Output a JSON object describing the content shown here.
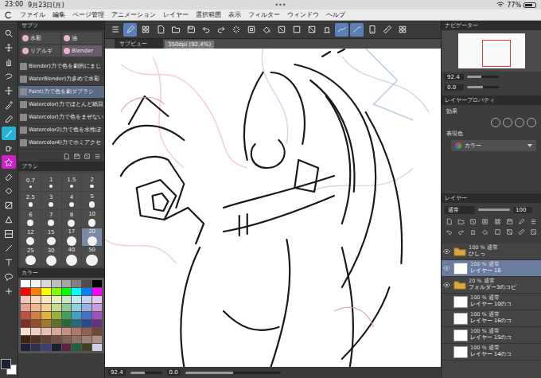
{
  "status_bar": {
    "time": "23:00",
    "date": "9月23日(月)",
    "dots": "•••",
    "battery": "77%",
    "battery_level": 0.77
  },
  "menu": [
    "ファイル",
    "編集",
    "ページ管理",
    "アニメーション",
    "レイヤー",
    "選択範囲",
    "表示",
    "フィルター",
    "ウィンドウ",
    "ヘルプ"
  ],
  "command_bar": [
    {
      "kind": "menu",
      "selected": false
    },
    {
      "kind": "pen",
      "selected": true
    },
    {
      "kind": "grid",
      "selected": false
    },
    {
      "kind": "file",
      "selected": false
    },
    {
      "kind": "folder",
      "selected": false
    },
    {
      "kind": "save",
      "selected": false
    },
    {
      "kind": "undo",
      "selected": false
    },
    {
      "kind": "redo",
      "selected": false
    },
    {
      "kind": "loading",
      "selected": false
    },
    {
      "kind": "transform",
      "selected": false
    },
    {
      "kind": "fill",
      "selected": false
    },
    {
      "kind": "clear",
      "selected": false
    },
    {
      "kind": "deselect",
      "selected": false
    },
    {
      "kind": "invert",
      "selected": false
    },
    {
      "kind": "snap",
      "selected": false
    },
    {
      "kind": "stabA",
      "selected": true
    },
    {
      "kind": "stabB",
      "selected": true
    },
    {
      "kind": "tablet",
      "selected": false
    },
    {
      "kind": "ruler",
      "selected": false
    },
    {
      "kind": "grid",
      "selected": false
    }
  ],
  "subview": {
    "label": "サブビュー"
  },
  "canvas_tab": {
    "title": "350dpi (92.4%)"
  },
  "tools": [
    {
      "kind": "zoom",
      "selected": false
    },
    {
      "kind": "move",
      "selected": false
    },
    {
      "kind": "hand",
      "selected": false
    },
    {
      "kind": "lasso",
      "selected": false
    },
    {
      "kind": "move",
      "selected": false
    },
    {
      "kind": "eyedrop",
      "selected": false
    },
    {
      "kind": "pencil",
      "selected": false
    },
    {
      "kind": "brush",
      "selected": true
    },
    {
      "kind": "airbrush",
      "selected": false
    },
    {
      "kind": "decoration",
      "selected": false
    },
    {
      "kind": "eraser",
      "selected": false
    },
    {
      "kind": "bucket",
      "selected": false
    },
    {
      "kind": "gradient",
      "selected": false
    },
    {
      "kind": "figure",
      "selected": false
    },
    {
      "kind": "frame",
      "selected": false
    },
    {
      "kind": "line",
      "selected": false
    },
    {
      "kind": "text",
      "selected": false
    },
    {
      "kind": "balloon",
      "selected": false
    },
    {
      "kind": "correct",
      "selected": false
    }
  ],
  "subtool_panel": {
    "title": "サブツ",
    "groups": [
      {
        "label": "水彩",
        "selected": false
      },
      {
        "label": "油",
        "selected": false
      },
      {
        "label": "リアルギ",
        "selected": false
      },
      {
        "label": "Blender",
        "selected": true
      }
    ],
    "items": [
      {
        "label": "Blender)力で色を劇的にまじ",
        "selected": false
      },
      {
        "label": "WaterBlender)力多めで水彩",
        "selected": false
      },
      {
        "label": "Paint)力で色を劇ダブラシ",
        "selected": true
      },
      {
        "label": "Watercolor)力でほとんど紙目",
        "selected": false
      },
      {
        "label": "Watercolor)力で色をまぜない",
        "selected": false
      },
      {
        "label": "Watercolor2)力で色を水性ぼ",
        "selected": false
      },
      {
        "label": "Watercolor4)力でホミアクセ",
        "selected": false
      }
    ]
  },
  "brush_size": {
    "title": "ブラシ",
    "sizes": [
      {
        "label": "0.7",
        "selected": false
      },
      {
        "label": "1",
        "selected": false
      },
      {
        "label": "1.5",
        "selected": false
      },
      {
        "label": "2",
        "selected": false
      },
      {
        "label": "2.5",
        "selected": false
      },
      {
        "label": "3",
        "selected": false
      },
      {
        "label": "4",
        "selected": false
      },
      {
        "label": "5",
        "selected": false
      },
      {
        "label": "6",
        "selected": false
      },
      {
        "label": "7",
        "selected": false
      },
      {
        "label": "8",
        "selected": false
      },
      {
        "label": "10",
        "selected": false
      },
      {
        "label": "12",
        "selected": false
      },
      {
        "label": "15",
        "selected": false
      },
      {
        "label": "17",
        "selected": false
      },
      {
        "label": "20",
        "selected": true
      },
      {
        "label": "25",
        "selected": false
      },
      {
        "label": "30",
        "selected": false
      },
      {
        "label": "40",
        "selected": false
      },
      {
        "label": "50",
        "selected": false
      }
    ]
  },
  "color_set": {
    "title": "カラー",
    "colors": [
      "#ffffff",
      "#f2f2f2",
      "#d9d9d9",
      "#bfbfbf",
      "#a6a6a6",
      "#808080",
      "#4d4d4d",
      "#000000",
      "#ff0000",
      "#ff8000",
      "#ffff00",
      "#80ff00",
      "#00ff00",
      "#00ffff",
      "#0080ff",
      "#ff00ff",
      "#f4c7b8",
      "#f9d9c0",
      "#fbe7c6",
      "#e8f0c0",
      "#c8e6c9",
      "#c5e8ef",
      "#c6d3f0",
      "#e6c8ee",
      "#e8a090",
      "#f0b890",
      "#f5d090",
      "#c8dc90",
      "#90cc98",
      "#90d0e0",
      "#98b0e8",
      "#d098e0",
      "#c05040",
      "#d08040",
      "#e0b040",
      "#98b040",
      "#40a060",
      "#40a0c0",
      "#4070c8",
      "#a050c0",
      "#803028",
      "#905028",
      "#a07828",
      "#607028",
      "#286838",
      "#286878",
      "#284890",
      "#683080",
      "#f8e0d0",
      "#f0d0c0",
      "#e8c0b0",
      "#d8a898",
      "#c89080",
      "#b07868",
      "#906050",
      "#704838",
      "#402010",
      "#503020",
      "#604030",
      "#705040",
      "#806050",
      "#907060",
      "#a08070",
      "#b09080",
      "#20203a",
      "#303050",
      "#404070",
      "#1c2033",
      "#602040",
      "#206040",
      "#404020",
      "#d0d0e0"
    ]
  },
  "current_colors": {
    "main": "#1c2033",
    "sub": "#ffffff"
  },
  "navigator": {
    "title": "ナビゲーター",
    "zoom": "92.4",
    "zoom_level": 0.45,
    "angle": "0.0",
    "angle_level": 0.5
  },
  "layer_property": {
    "title": "レイヤープロパティ",
    "effect_label": "効果",
    "color_label": "表現色",
    "color_value": "カラー"
  },
  "layers": {
    "title": "レイヤー",
    "blend": "通常",
    "opacity": "100",
    "opacity_level": 1,
    "items": [
      {
        "mode": "100 % 通常",
        "name": "ひしっ",
        "kind": "folder",
        "selected": false,
        "visible": true
      },
      {
        "mode": "100 % 通常",
        "name": "レイヤー 18",
        "kind": "layer",
        "selected": true,
        "visible": true
      },
      {
        "mode": "20 % 通常",
        "name": "フォルダー3のコピ",
        "kind": "folder",
        "selected": false,
        "visible": true
      },
      {
        "mode": "100 % 通常",
        "name": "レイヤー 10のコ",
        "kind": "layer",
        "selected": false,
        "visible": false
      },
      {
        "mode": "100 % 通常",
        "name": "レイヤー 16のコ",
        "kind": "layer",
        "selected": false,
        "visible": false
      },
      {
        "mode": "100 % 通常",
        "name": "レイヤー 15のコ",
        "kind": "layer",
        "selected": false,
        "visible": false
      },
      {
        "mode": "100 % 通常",
        "name": "レイヤー 14のコ",
        "kind": "layer",
        "selected": false,
        "visible": false
      }
    ]
  },
  "canvas_footer": {
    "zoom": "92.4",
    "zoom_level": 0.45,
    "angle": "0.0",
    "angle_level": 0.5
  }
}
